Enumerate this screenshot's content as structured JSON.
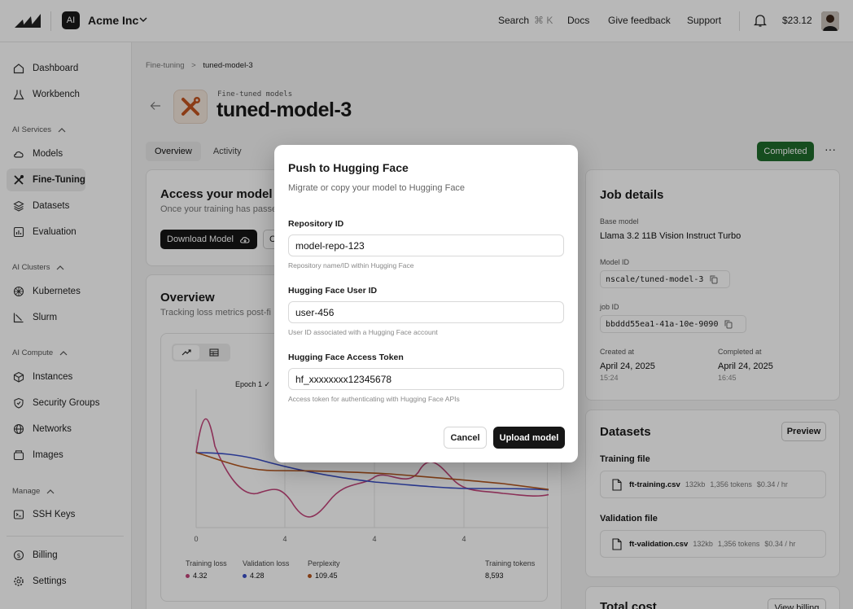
{
  "topbar": {
    "org_badge": "AI",
    "org_name": "Acme Inc",
    "search_label": "Search",
    "search_shortcut": "⌘ K",
    "docs": "Docs",
    "feedback": "Give feedback",
    "support": "Support",
    "balance": "$23.12"
  },
  "sidebar": {
    "dashboard": "Dashboard",
    "workbench": "Workbench",
    "section_ai_services": "AI Services",
    "models": "Models",
    "fine_tuning": "Fine-Tuning",
    "datasets": "Datasets",
    "evaluation": "Evaluation",
    "section_ai_clusters": "AI Clusters",
    "kubernetes": "Kubernetes",
    "slurm": "Slurm",
    "section_ai_compute": "AI Compute",
    "instances": "Instances",
    "security_groups": "Security Groups",
    "networks": "Networks",
    "images": "Images",
    "section_manage": "Manage",
    "ssh_keys": "SSH Keys",
    "billing": "Billing",
    "settings": "Settings"
  },
  "breadcrumb": {
    "root": "Fine-tuning",
    "sep": ">",
    "current": "tuned-model-3"
  },
  "header": {
    "kicker": "Fine-tuned models",
    "title": "tuned-model-3"
  },
  "tabs": {
    "overview": "Overview",
    "activity": "Activity"
  },
  "status": {
    "label": "Completed",
    "more": "···"
  },
  "access": {
    "title": "Access your model",
    "subtitle": "Once your training has passe",
    "download_label": "Download Model",
    "copy_stub": "C"
  },
  "overview": {
    "title": "Overview",
    "subtitle": "Tracking loss metrics post-fi",
    "epoch_label": "Epoch 1 ✓",
    "x_ticks": [
      "0",
      "4",
      "4",
      "4",
      "4"
    ],
    "legend": {
      "training_loss_label": "Training loss",
      "training_loss_value": "4.32",
      "validation_loss_label": "Validation loss",
      "validation_loss_value": "4.28",
      "perplexity_label": "Perplexity",
      "perplexity_value": "109.45",
      "tokens_label": "Training tokens",
      "tokens_value": "8,593"
    }
  },
  "job": {
    "title": "Job details",
    "base_model_label": "Base model",
    "base_model_value": "Llama 3.2 11B Vision Instruct Turbo",
    "model_id_label": "Model ID",
    "model_id_value": "nscale/tuned-model-3",
    "job_id_label": "job ID",
    "job_id_value": "bbddd55ea1-41a-10e-9090",
    "created_label": "Created at",
    "created_date": "April 24, 2025",
    "created_time": "15:24",
    "completed_label": "Completed at",
    "completed_date": "April 24, 2025",
    "completed_time": "16:45"
  },
  "datasets": {
    "title": "Datasets",
    "preview_label": "Preview",
    "training_label": "Training file",
    "training_name": "ft-training.csv",
    "training_size": "132kb",
    "training_tokens": "1,356 tokens",
    "training_price": "$0.34 / hr",
    "validation_label": "Validation file",
    "validation_name": "ft-validation.csv",
    "validation_size": "132kb",
    "validation_tokens": "1,356 tokens",
    "validation_price": "$0.34 / hr"
  },
  "cost": {
    "title": "Total cost",
    "billing_label": "View billing"
  },
  "modal": {
    "title": "Push to Hugging Face",
    "subtitle": "Migrate or copy your model to Hugging Face",
    "repo_label": "Repository ID",
    "repo_value": "model-repo-123",
    "repo_help": "Repository name/ID within Hugging Face",
    "user_label": "Hugging Face User ID",
    "user_value": "user-456",
    "user_help": "User ID associated with a Hugging Face account",
    "token_label": "Hugging Face Access Token",
    "token_value": "hf_xxxxxxxx12345678",
    "token_help": "Access token for authenticating with Hugging Face APIs",
    "cancel_label": "Cancel",
    "upload_label": "Upload model"
  },
  "colors": {
    "training_loss": "#c2447a",
    "validation_loss": "#3a4ec7",
    "perplexity": "#b5561f",
    "completed_badge": "#1f6b2b",
    "model_icon": "#c2541f"
  }
}
